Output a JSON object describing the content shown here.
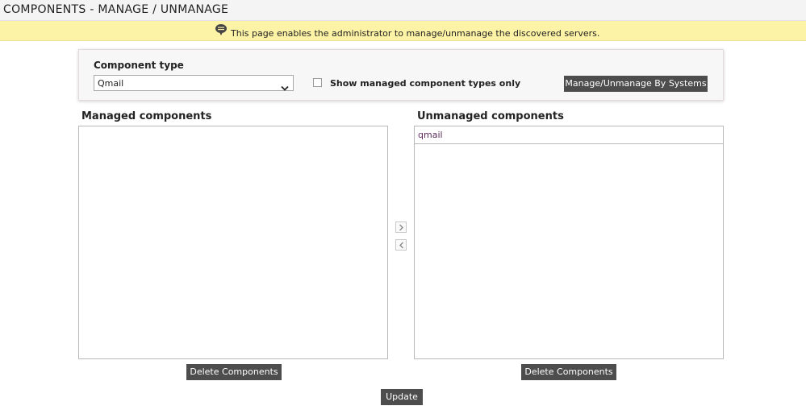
{
  "header": {
    "title": "COMPONENTS - MANAGE / UNMANAGE"
  },
  "info": {
    "icon": "speech-bubble-icon",
    "text": "This page enables the administrator to manage/unmanage the discovered servers."
  },
  "filter": {
    "label": "Component type",
    "select": {
      "value": "Qmail"
    },
    "checkbox": {
      "label": "Show managed component types only",
      "checked": false
    },
    "systems_button": "Manage/Unmanage By Systems"
  },
  "managed": {
    "title": "Managed components",
    "items": [],
    "delete_label": "Delete Components"
  },
  "unmanaged": {
    "title": "Unmanaged components",
    "items": [
      "qmail"
    ],
    "delete_label": "Delete Components"
  },
  "transfer": {
    "right_icon": "chevron-right-icon",
    "left_icon": "chevron-left-icon"
  },
  "update_label": "Update",
  "colors": {
    "button": "#4d4d4d",
    "infobar": "#fdf3a6",
    "item_text": "#5b2c5d"
  }
}
